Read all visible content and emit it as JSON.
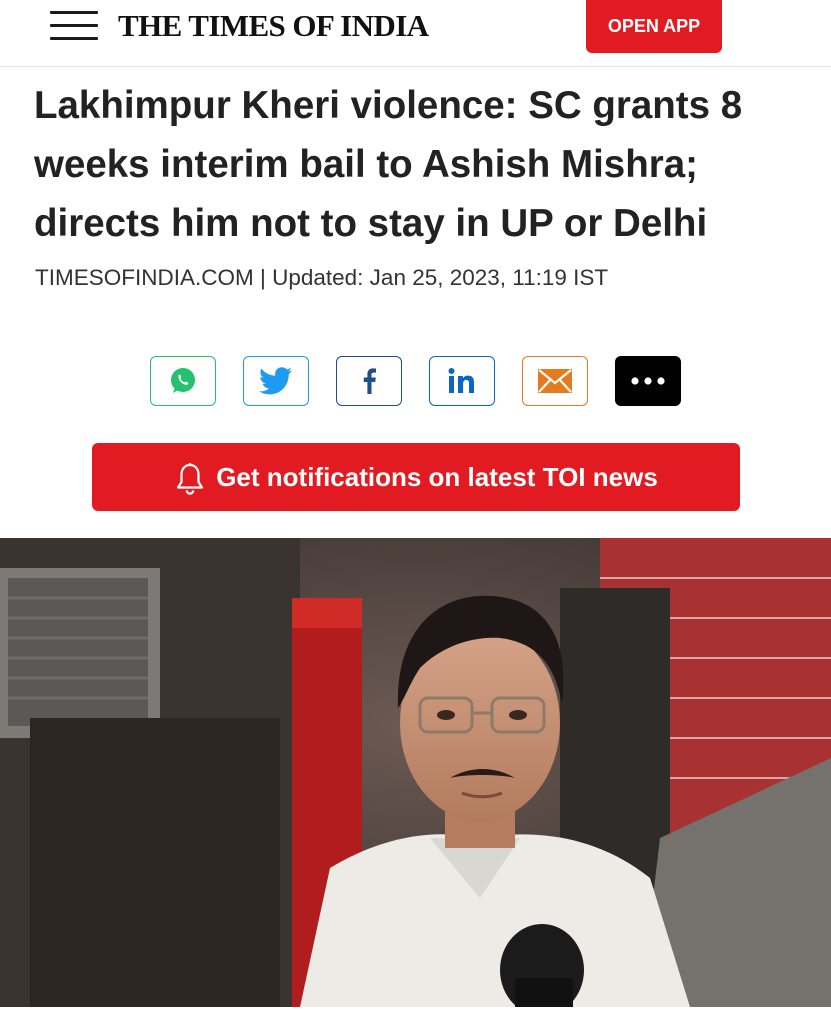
{
  "header": {
    "logo_text": "THE TIMES OF INDIA",
    "open_app_label": "OPEN APP",
    "menu_icon": "hamburger-menu-icon",
    "accent_color": "#e21b22"
  },
  "article": {
    "headline": "Lakhimpur Kheri violence: SC grants 8 weeks interim bail to Ashish Mishra; directs him not to stay in UP or Delhi",
    "source": "TIMESOFINDIA.COM",
    "separator": " | ",
    "updated": "Updated: Jan 25, 2023, 11:19 IST"
  },
  "share": {
    "buttons": [
      {
        "name": "whatsapp",
        "icon": "whatsapp-icon",
        "color": "#25c16f"
      },
      {
        "name": "twitter",
        "icon": "twitter-icon",
        "color": "#1d9bf0"
      },
      {
        "name": "facebook",
        "icon": "facebook-icon",
        "color": "#1e4f86"
      },
      {
        "name": "linkedin",
        "icon": "linkedin-icon",
        "color": "#0a66c2"
      },
      {
        "name": "email",
        "icon": "email-icon",
        "color": "#e67a1e"
      },
      {
        "name": "more",
        "icon": "more-dots-icon",
        "color": "#000000"
      }
    ]
  },
  "notification": {
    "label": "Get notifications on latest TOI news",
    "icon": "bell-icon"
  },
  "hero_image": {
    "description_icon": "article-photo"
  }
}
